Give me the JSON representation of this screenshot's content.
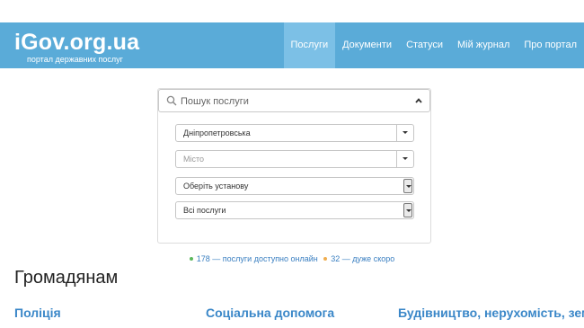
{
  "header": {
    "logo": "iGov.org.ua",
    "tagline": "портал державних послуг",
    "nav": [
      {
        "label": "Послуги",
        "active": true
      },
      {
        "label": "Документи",
        "active": false
      },
      {
        "label": "Статуси",
        "active": false
      },
      {
        "label": "Мій журнал",
        "active": false
      },
      {
        "label": "Про портал",
        "active": false
      }
    ]
  },
  "search": {
    "placeholder": "Пошук послуги",
    "region": "Дніпропетровська",
    "city_placeholder": "Місто",
    "office": "Оберіть установу",
    "services": "Всі послуги"
  },
  "stats": {
    "online": "178 — послуги доступно онлайн",
    "soon": "32 — дуже скоро"
  },
  "section": {
    "title": "Громадянам",
    "categories": [
      "Поліція",
      "Соціальна допомога",
      "Будівництво, нерухомість, земля"
    ]
  },
  "colors": {
    "header_bg": "#5aabd8",
    "nav_active_bg": "#7cc0e6",
    "link": "#3a87c8"
  },
  "icons": [
    "search-icon",
    "chevron-up-icon",
    "caret-down-icon"
  ]
}
